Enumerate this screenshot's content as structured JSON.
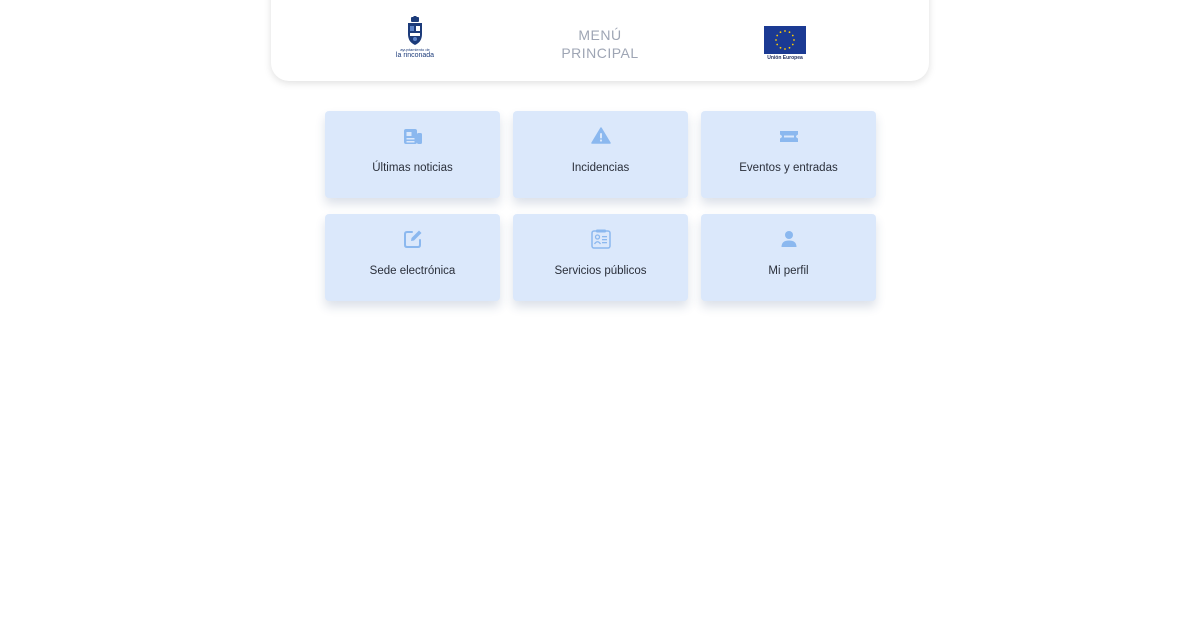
{
  "header": {
    "title_line1": "MENÚ",
    "title_line2": "PRINCIPAL",
    "left_logo": {
      "icon": "coat-of-arms-icon",
      "small_text": "ayuntamiento de",
      "name": "la rinconada"
    },
    "right_logo": {
      "icon": "eu-flag-icon",
      "caption": "Unión Europea"
    }
  },
  "menu": {
    "items": [
      {
        "label": "Últimas noticias",
        "icon": "newspaper-icon"
      },
      {
        "label": "Incidencias",
        "icon": "warning-icon"
      },
      {
        "label": "Eventos y entradas",
        "icon": "ticket-icon"
      },
      {
        "label": "Sede electrónica",
        "icon": "edit-icon"
      },
      {
        "label": "Servicios públicos",
        "icon": "public-services-icon"
      },
      {
        "label": "Mi perfil",
        "icon": "user-icon"
      }
    ]
  },
  "colors": {
    "card_bg": "#dbe8fb",
    "icon": "#8bb8ef",
    "title": "#9ea5b4",
    "eu_blue": "#1b3a93",
    "eu_star": "#ffcc00"
  }
}
